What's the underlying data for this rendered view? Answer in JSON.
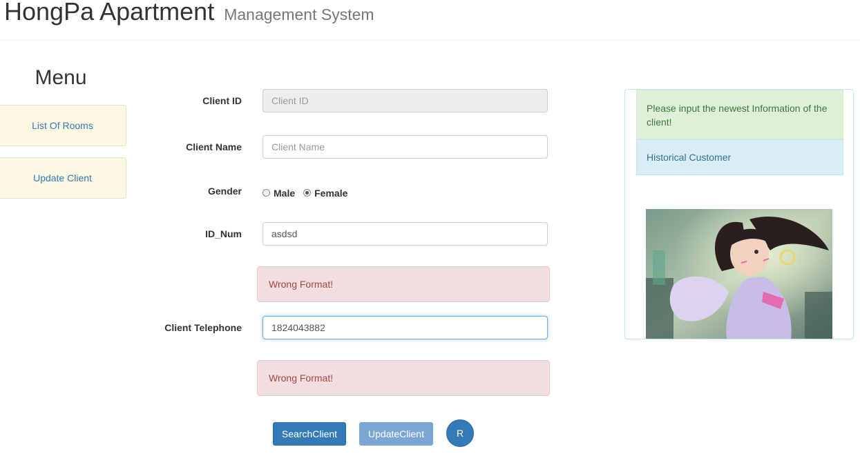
{
  "header": {
    "title": "HongPa Apartment",
    "subtitle": "Management System"
  },
  "menu": {
    "heading": "Menu",
    "items": [
      {
        "label": "List Of Rooms"
      },
      {
        "label": "Update Client"
      }
    ]
  },
  "form": {
    "client_id": {
      "label": "Client ID",
      "placeholder": "Client ID",
      "value": ""
    },
    "client_name": {
      "label": "Client Name",
      "placeholder": "Client Name",
      "value": ""
    },
    "gender": {
      "label": "Gender",
      "options": [
        "Male",
        "Female"
      ],
      "selected": "Female"
    },
    "id_num": {
      "label": "ID_Num",
      "value": "asdsd",
      "error": "Wrong Format!"
    },
    "telephone": {
      "label": "Client Telephone",
      "value": "1824043882",
      "error": "Wrong Format!"
    }
  },
  "buttons": {
    "search": "SearchClient",
    "update": "UpdateClient",
    "reset": "R"
  },
  "side_panel": {
    "notice": "Please input the newest Information of the client!",
    "historical": "Historical Customer",
    "picture_icon": "anime-character-illustration"
  },
  "colors": {
    "primary": "#337ab7",
    "danger_bg": "#f2dede",
    "danger_text": "#a94442",
    "menu_bg": "#fcf8e3"
  }
}
